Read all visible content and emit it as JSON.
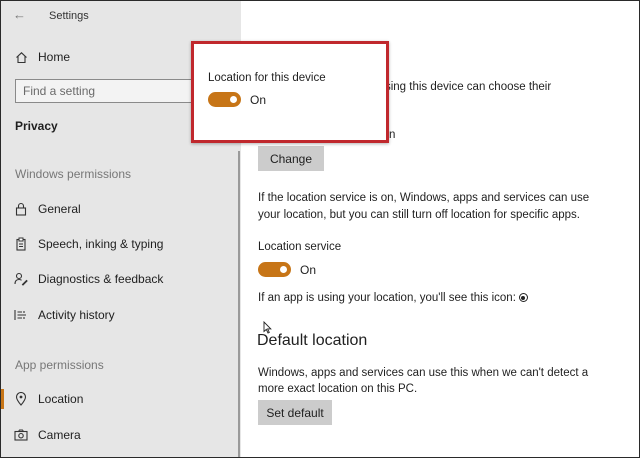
{
  "window": {
    "title": "Settings"
  },
  "sidebar": {
    "home_label": "Home",
    "search_placeholder": "Find a setting",
    "section": "Privacy",
    "windows_permissions_title": "Windows permissions",
    "windows_items": [
      {
        "label": "General",
        "icon": "lock-icon"
      },
      {
        "label": "Speech, inking & typing",
        "icon": "clipboard-icon"
      },
      {
        "label": "Diagnostics & feedback",
        "icon": "feedback-icon"
      },
      {
        "label": "Activity history",
        "icon": "history-icon"
      }
    ],
    "app_permissions_title": "App permissions",
    "app_items": [
      {
        "label": "Location",
        "icon": "location-icon",
        "selected": true
      },
      {
        "label": "Camera",
        "icon": "camera-icon"
      }
    ],
    "accent_color": "#c77517"
  },
  "main": {
    "partial_line1": "n using this device can choose their",
    "partial_line2": "n",
    "change_button": "Change",
    "location_info_line1": "If the location service is on, Windows, apps and services can use",
    "location_info_line2": "your location, but you can still turn off location for specific apps.",
    "location_service_label": "Location service",
    "location_service_state": "On",
    "icon_info": "If an app is using your location, you'll see this icon:",
    "default_location_heading": "Default location",
    "default_info_line1": "Windows, apps and services can use this when we can't detect a",
    "default_info_line2": "more exact location on this PC.",
    "set_default_button": "Set default"
  },
  "popup": {
    "title": "Location for this device",
    "toggle_state": "On",
    "highlight_color": "#c0282d"
  }
}
